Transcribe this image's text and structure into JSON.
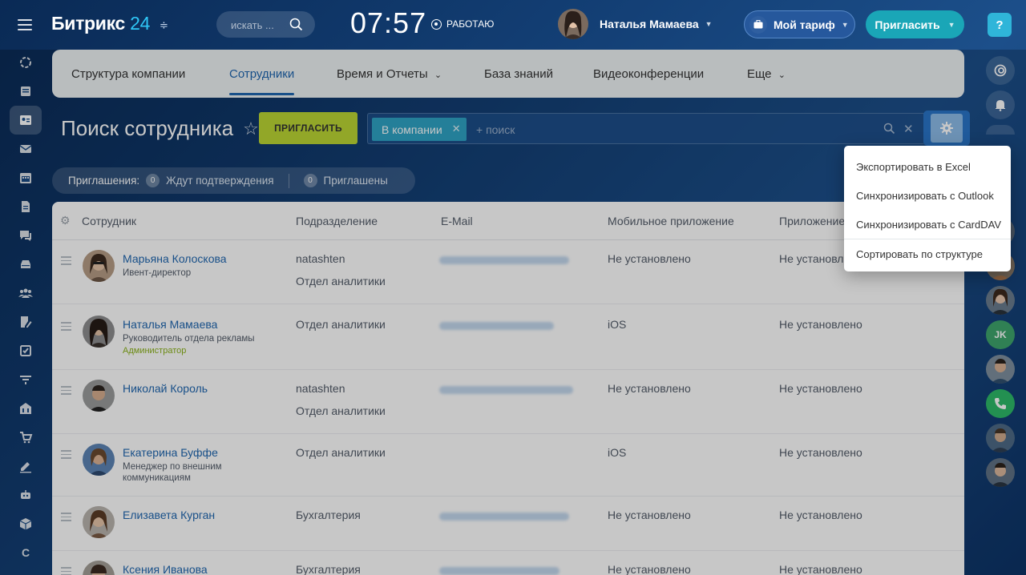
{
  "header": {
    "logo_name": "Битрикс",
    "logo_num": "24",
    "search_placeholder": "искать ...",
    "clock": "07:57",
    "work_status": "РАБОТАЮ",
    "user_name": "Наталья Мамаева",
    "tariff_label": "Мой тариф",
    "invite_label": "Пригласить",
    "help": "?"
  },
  "tabs": [
    {
      "label": "Структура компании"
    },
    {
      "label": "Сотрудники",
      "active": true
    },
    {
      "label": "Время и Отчеты",
      "has_caret": true
    },
    {
      "label": "База знаний"
    },
    {
      "label": "Видеоконференции"
    },
    {
      "label": "Еще",
      "has_caret": true
    }
  ],
  "page": {
    "title": "Поиск сотрудника",
    "invite_button": "ПРИГЛАСИТЬ",
    "filter_chip": "В компании",
    "filter_placeholder": "+ поиск"
  },
  "invitations": {
    "label": "Приглашения:",
    "pending_count": "0",
    "pending_label": "Ждут подтверждения",
    "invited_count": "0",
    "invited_label": "Приглашены"
  },
  "table": {
    "columns": [
      "Сотрудник",
      "Подразделение",
      "E-Mail",
      "Мобильное приложение",
      "Приложение"
    ],
    "rows": [
      {
        "name": "Марьяна Колоскова",
        "position": "Ивент-директор",
        "role": "",
        "dept": [
          "natashten",
          "Отдел аналитики"
        ],
        "mobile": "Не установлено",
        "app": "Не установлено"
      },
      {
        "name": "Наталья Мамаева",
        "position": "Руководитель отдела рекламы",
        "role": "Администратор",
        "dept": [
          "Отдел аналитики"
        ],
        "mobile": "iOS",
        "app": "Не установлено"
      },
      {
        "name": "Николай Король",
        "position": "",
        "role": "",
        "dept": [
          "natashten",
          "Отдел аналитики"
        ],
        "mobile": "Не установлено",
        "app": "Не установлено"
      },
      {
        "name": "Екатерина Буффе",
        "position": "Менеджер по внешним коммуникациям",
        "role": "",
        "dept": [
          "Отдел аналитики"
        ],
        "mobile": "iOS",
        "app": "Не установлено"
      },
      {
        "name": "Елизавета Курган",
        "position": "",
        "role": "",
        "dept": [
          "Бухгалтерия"
        ],
        "mobile": "Не установлено",
        "app": "Не установлено"
      },
      {
        "name": "Ксения Иванова",
        "position": "",
        "role": "",
        "dept": [
          "Бухгалтерия"
        ],
        "mobile": "Не установлено",
        "app": "Не установлено"
      }
    ]
  },
  "popup_menu": {
    "items": [
      "Экспортировать в Excel",
      "Синхронизировать с Outlook",
      "Синхронизировать с CardDAV",
      "Сортировать по структуре"
    ]
  },
  "right_sidebar": {
    "jk_initials": "JK"
  },
  "colors": {
    "accent": "#2067b0",
    "invite_green": "#bbd634",
    "teal": "#1aa6b7",
    "admin": "#8bb21a"
  }
}
